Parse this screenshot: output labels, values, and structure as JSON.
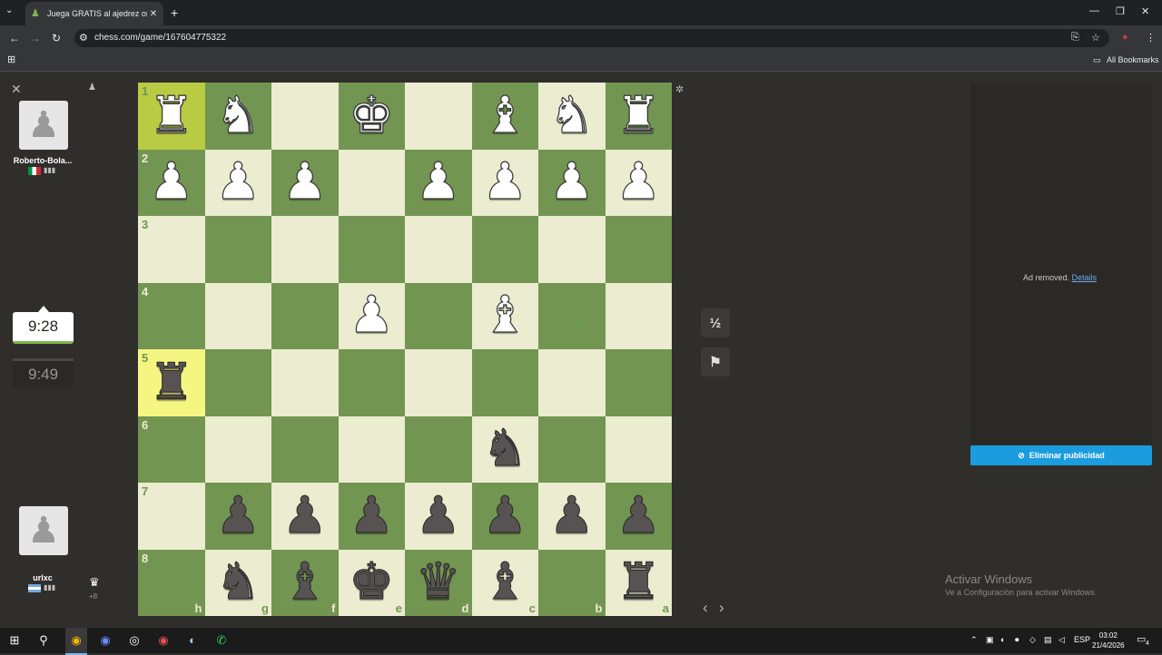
{
  "browser": {
    "tab_title": "Juega GRATIS al ajedrez online",
    "url": "chess.com/game/167604775322",
    "bookmarks_label": "All Bookmarks"
  },
  "top_player": {
    "name": "Roberto-Bola...",
    "clock": "9:49"
  },
  "bottom_player": {
    "name": "urlxc",
    "clock": "9:28",
    "material_advantage": "+8"
  },
  "board": {
    "orientation": "black",
    "ranks": [
      "1",
      "2",
      "3",
      "4",
      "5",
      "6",
      "7",
      "8"
    ],
    "files": [
      "h",
      "g",
      "f",
      "e",
      "d",
      "c",
      "b",
      "a"
    ],
    "rows": [
      [
        "wR",
        "wN",
        "",
        "wK",
        "",
        "wB",
        "wN",
        "wR"
      ],
      [
        "wP",
        "wP",
        "wP",
        "",
        "wP",
        "wP",
        "wP",
        "wP"
      ],
      [
        "",
        "",
        "",
        "",
        "",
        "",
        "",
        ""
      ],
      [
        "",
        "",
        "",
        "wP",
        "",
        "wB",
        "",
        ""
      ],
      [
        "bR",
        "",
        "",
        "",
        "",
        "",
        "",
        ""
      ],
      [
        "",
        "",
        "",
        "",
        "",
        "bN",
        "",
        ""
      ],
      [
        "",
        "bP",
        "bP",
        "bP",
        "bP",
        "bP",
        "bP",
        "bP"
      ],
      [
        "",
        "bN",
        "bB",
        "bK",
        "bQ",
        "bB",
        "",
        "bR"
      ]
    ],
    "highlighted_squares": [
      "h5",
      "h1"
    ]
  },
  "controls": {
    "draw_label": "½",
    "resign_icon": "flag-icon"
  },
  "ad": {
    "removed_text": "Ad removed.",
    "details_link": "Details",
    "remove_button": "Eliminar publicidad"
  },
  "windows": {
    "activate_title": "Activar Windows",
    "activate_sub": "Ve a Configuración para activar Windows.",
    "lang": "ESP",
    "time": "03:02",
    "date": "21/4/2026",
    "notif_count": "4"
  },
  "colors": {
    "board_light": "#ebecd0",
    "board_dark": "#739552",
    "highlight": "#f5f682",
    "accent_blue": "#1b9cdf"
  }
}
